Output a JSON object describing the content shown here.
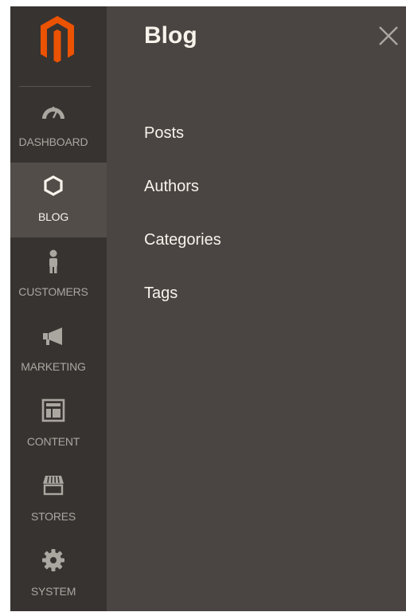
{
  "brand": {
    "logo_color": "#eb5202",
    "logo_name": "magento-logo"
  },
  "sidebar": {
    "items": [
      {
        "label": "DASHBOARD",
        "icon": "speedometer-icon",
        "active": false
      },
      {
        "label": "BLOG",
        "icon": "hexagon-icon",
        "active": true
      },
      {
        "label": "CUSTOMERS",
        "icon": "person-icon",
        "active": false
      },
      {
        "label": "MARKETING",
        "icon": "megaphone-icon",
        "active": false
      },
      {
        "label": "CONTENT",
        "icon": "layout-icon",
        "active": false
      },
      {
        "label": "STORES",
        "icon": "storefront-icon",
        "active": false
      },
      {
        "label": "SYSTEM",
        "icon": "gear-icon",
        "active": false
      }
    ]
  },
  "panel": {
    "title": "Blog",
    "close_icon": "close-icon",
    "links": [
      "Posts",
      "Authors",
      "Categories",
      "Tags"
    ]
  },
  "colors": {
    "sidebar_bg": "#373330",
    "sidebar_active_bg": "#524d49",
    "panel_bg": "#4a4542",
    "text_light": "#f7f3eb",
    "text_muted": "#aaa6a0"
  }
}
